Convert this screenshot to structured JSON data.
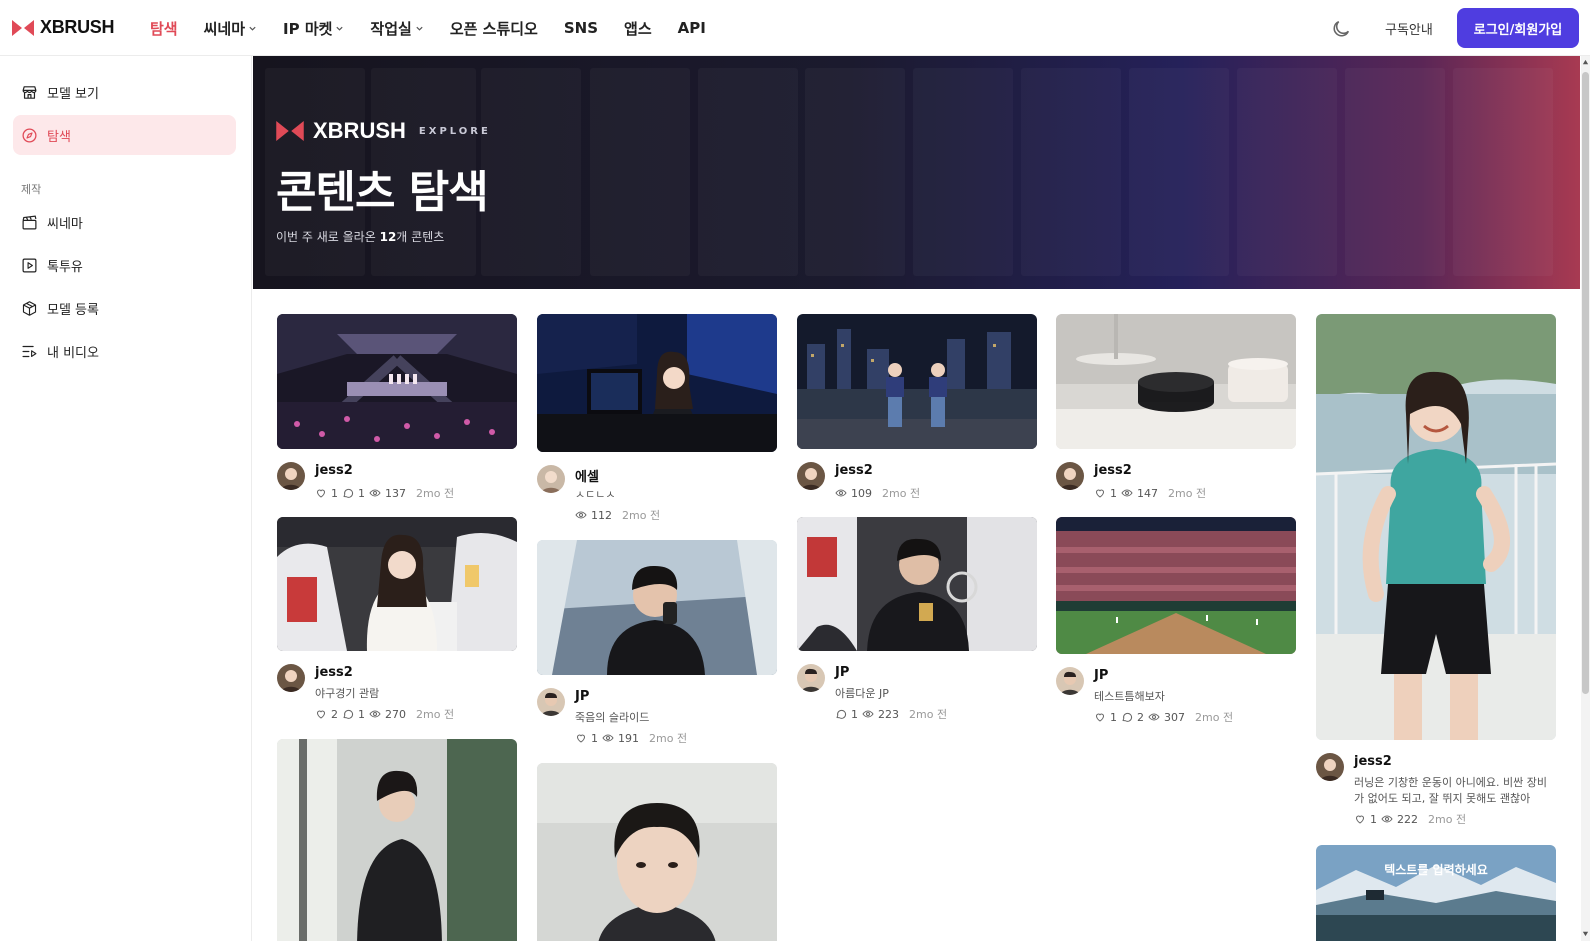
{
  "brand": {
    "name": "XBRUSH",
    "accent": "#e04a57",
    "primary": "#4f3de0"
  },
  "nav": {
    "items": [
      {
        "label": "탐색",
        "active": true,
        "dropdown": false
      },
      {
        "label": "씨네마",
        "active": false,
        "dropdown": true
      },
      {
        "label": "IP 마켓",
        "active": false,
        "dropdown": true
      },
      {
        "label": "작업실",
        "active": false,
        "dropdown": true
      },
      {
        "label": "오픈 스튜디오",
        "active": false,
        "dropdown": false
      },
      {
        "label": "SNS",
        "active": false,
        "dropdown": false
      },
      {
        "label": "앱스",
        "active": false,
        "dropdown": false
      },
      {
        "label": "API",
        "active": false,
        "dropdown": false
      }
    ],
    "subscribe": "구독안내",
    "login": "로그인/회원가입",
    "theme_icon": "moon-icon"
  },
  "sidebar": {
    "top_items": [
      {
        "label": "모델 보기",
        "icon": "store-icon"
      },
      {
        "label": "탐색",
        "icon": "compass-icon",
        "active": true
      }
    ],
    "section_title": "제작",
    "items": [
      {
        "label": "씨네마",
        "icon": "clapperboard-icon"
      },
      {
        "label": "톡투유",
        "icon": "play-square-icon"
      },
      {
        "label": "모델 등록",
        "icon": "box-icon"
      },
      {
        "label": "내 비디오",
        "icon": "list-video-icon"
      }
    ]
  },
  "hero": {
    "brand": "XBRUSH",
    "tag": "EXPLORE",
    "title": "콘텐츠 탐색",
    "sub_prefix": "이번 주 새로 올라온 ",
    "sub_count": "12",
    "sub_suffix": "개 콘텐츠"
  },
  "cards": [
    {
      "author": "jess2",
      "desc": "",
      "likes": "1",
      "comments": "1",
      "views": "137",
      "ago": "2mo 전"
    },
    {
      "author": "에셀",
      "desc": "ㅅㄷㄴㅅ",
      "likes": "",
      "comments": "",
      "views": "112",
      "ago": "2mo 전"
    },
    {
      "author": "jess2",
      "desc": "",
      "likes": "",
      "comments": "",
      "views": "109",
      "ago": "2mo 전"
    },
    {
      "author": "jess2",
      "desc": "",
      "likes": "1",
      "comments": "",
      "views": "147",
      "ago": "2mo 전"
    },
    {
      "author": "jess2",
      "desc": "러닝은 기창한 운동이 아니에요. 비싼 장비가 없어도 되고, 잘 뛰지 못해도 괜찮아요....",
      "likes": "1",
      "comments": "",
      "views": "222",
      "ago": "2mo 전"
    },
    {
      "author": "jess2",
      "desc": "야구경기 관람",
      "likes": "2",
      "comments": "1",
      "views": "270",
      "ago": "2mo 전"
    },
    {
      "author": "JP",
      "desc": "죽음의 슬라이드",
      "likes": "1",
      "comments": "",
      "views": "191",
      "ago": "2mo 전"
    },
    {
      "author": "JP",
      "desc": "아름다운 JP",
      "likes": "",
      "comments": "1",
      "views": "223",
      "ago": "2mo 전"
    },
    {
      "author": "JP",
      "desc": "테스트틈해보자",
      "likes": "1",
      "comments": "2",
      "views": "307",
      "ago": "2mo 전"
    },
    {
      "author": "",
      "desc": "",
      "likes": "",
      "comments": "",
      "views": "",
      "ago": ""
    },
    {
      "author": "",
      "desc": "",
      "likes": "",
      "comments": "",
      "views": "",
      "ago": ""
    },
    {
      "author": "",
      "desc": "",
      "likes": "",
      "comments": "",
      "views": "",
      "ago": ""
    }
  ],
  "overlay_text": "텍스트를 입력하세요"
}
